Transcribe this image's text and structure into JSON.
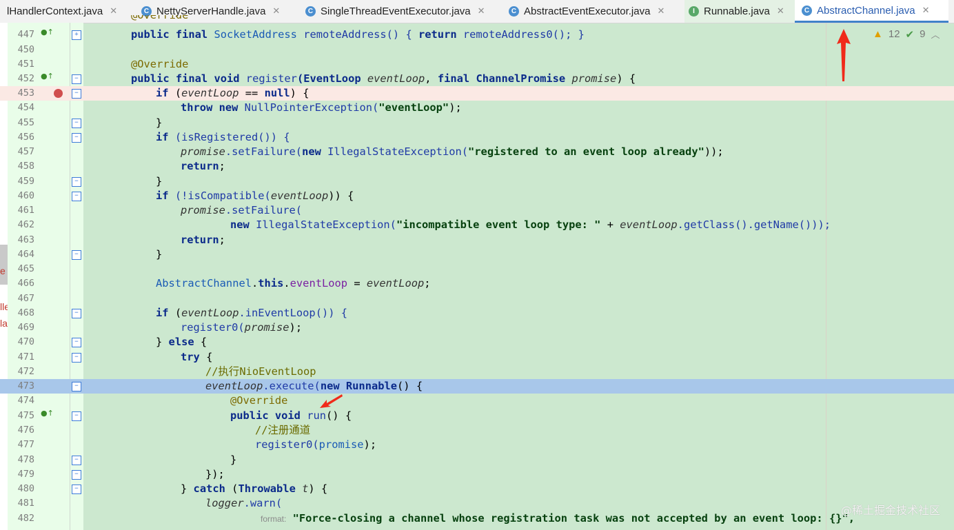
{
  "tabs": [
    {
      "label": "lHandlerContext.java",
      "icon": "class-icon",
      "active": false
    },
    {
      "label": "NettyServerHandle.java",
      "icon": "class-icon",
      "active": false
    },
    {
      "label": "SingleThreadEventExecutor.java",
      "icon": "class-icon",
      "active": false
    },
    {
      "label": "AbstractEventExecutor.java",
      "icon": "class-icon",
      "active": false
    },
    {
      "label": "Runnable.java",
      "icon": "interface-icon",
      "active": false
    },
    {
      "label": "AbstractChannel.java",
      "icon": "class-icon",
      "active": true
    }
  ],
  "inspections": {
    "warnings": "12",
    "ok": "9"
  },
  "left_fragments": [
    "e",
    "lle",
    "la"
  ],
  "param_hint": "format:",
  "watermark": "@稀土掘金技术社区",
  "lines": [
    {
      "n": "447"
    },
    {
      "n": "450"
    },
    {
      "n": "451"
    },
    {
      "n": "452"
    },
    {
      "n": "453"
    },
    {
      "n": "454"
    },
    {
      "n": "455"
    },
    {
      "n": "456"
    },
    {
      "n": "457"
    },
    {
      "n": "458"
    },
    {
      "n": "459"
    },
    {
      "n": "460"
    },
    {
      "n": "461"
    },
    {
      "n": "462"
    },
    {
      "n": "463"
    },
    {
      "n": "464"
    },
    {
      "n": "465"
    },
    {
      "n": "466"
    },
    {
      "n": "467"
    },
    {
      "n": "468"
    },
    {
      "n": "469"
    },
    {
      "n": "470"
    },
    {
      "n": "471"
    },
    {
      "n": "472"
    },
    {
      "n": "473"
    },
    {
      "n": "474"
    },
    {
      "n": "475"
    },
    {
      "n": "476"
    },
    {
      "n": "477"
    },
    {
      "n": "478"
    },
    {
      "n": "479"
    },
    {
      "n": "480"
    },
    {
      "n": "481"
    },
    {
      "n": "482"
    }
  ],
  "code": {
    "l446": "@Override",
    "l447a": "public final ",
    "l447b": "SocketAddress",
    "l447c": " remoteAddress() { ",
    "l447d": "return",
    "l447e": " remoteAddress0(); }",
    "l451": "@Override",
    "l452a": "public final void ",
    "l452b": "register",
    "l452c": "(EventLoop ",
    "l452d": "eventLoop",
    "l452e": ", ",
    "l452f": "final ",
    "l452g": "ChannelPromise ",
    "l452h": "promise",
    "l452i": ") {",
    "l453a": "if ",
    "l453b": "(",
    "l453c": "eventLoop",
    "l453d": " == ",
    "l453e": "null",
    "l453f": ") {",
    "l454a": "throw new ",
    "l454b": "NullPointerException(",
    "l454c": "\"eventLoop\"",
    "l454d": ");",
    "l455": "}",
    "l456a": "if ",
    "l456b": "(isRegistered()) {",
    "l457a": "promise",
    ".l457b": "",
    "l457c": ".setFailure(",
    "l457d": "new ",
    "l457e": "IllegalStateException(",
    "l457f": "\"registered to an event loop already\"",
    "l457g": "));",
    "l458a": "return",
    ";l458b": "",
    "l459": "}",
    "l460a": "if ",
    "l460b": "(!isCompatible(",
    "l460c": "eventLoop",
    "l460d": ")) {",
    "l461a": "promise",
    "l461b": ".setFailure(",
    "l462a": "new ",
    "l462b": "IllegalStateException(",
    "l462c": "\"incompatible event loop type: \"",
    "l462d": " + ",
    "l462e": "eventLoop",
    "l462f": ".getClass().getName()));",
    "l463a": "return",
    "l464": "}",
    "l466a": "AbstractChannel",
    "l466b": ".",
    "l466c": "this",
    "l466d": ".",
    "l466e": "eventLoop",
    "l466f": " = ",
    "l466g": "eventLoop",
    "l466h": ";",
    "l468a": "if ",
    "l468b": "(",
    "l468c": "eventLoop",
    "l468d": ".inEventLoop()) {",
    "l469a": "register0(",
    "l469b": "promise",
    "l469c": ");",
    "l470a": "} ",
    "l470b": "else",
    " l470c": " {",
    "l471a": "try",
    " l471b": " {",
    "l472": "//执行NioEventLoop",
    "l473a": "eventLoop",
    "l473b": ".execute(",
    "l473c": "new ",
    "l473d": "Runnable",
    "l473e": "() {",
    "l474": "@Override",
    "l475a": "public void ",
    "l475b": "run",
    "l475c": "() {",
    "l476": "//注册通道",
    "l477a": "register0(",
    "l477b": "promise",
    "l477c": ");",
    "l478": "}",
    "l479": "});",
    "l480a": "} ",
    "l480b": "catch",
    " l480c": " (",
    "l480d": "Throwable ",
    "l480e": "t",
    ") {": "",
    "l481a": "logger",
    "l481b": ".warn(",
    "l482": "\"Force-closing a channel whose registration task was not accepted by an event loop: {}\","
  }
}
